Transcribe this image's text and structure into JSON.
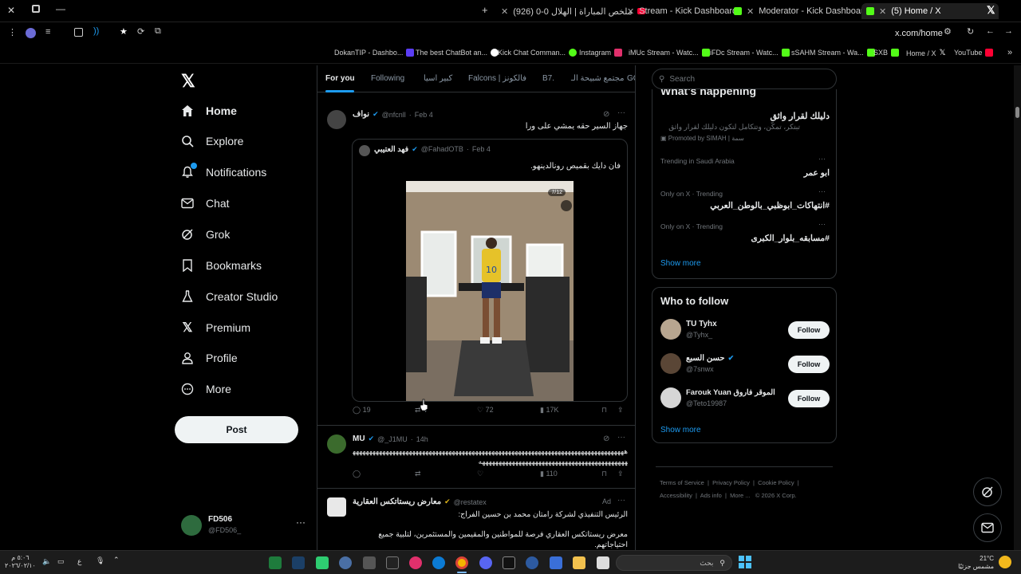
{
  "browser": {
    "tabs": [
      {
        "title": "(926) ملخص المباراة | الهلال 0-0",
        "icon_color": "#ff0033"
      },
      {
        "title": "Stream - Kick Dashboard",
        "icon_color": "#53fc18"
      },
      {
        "title": "Moderator - Kick Dashboard",
        "icon_color": "#53fc18"
      },
      {
        "title": "(5) Home / X",
        "icon_color": "#ffffff"
      }
    ],
    "url": "x.com/home",
    "bookmarks": [
      {
        "label": "DokanTIP - Dashbo...",
        "color": "#5b3df5"
      },
      {
        "label": "The best ChatBot an...",
        "color": "#ffffff"
      },
      {
        "label": "Kick Chat Comman...",
        "color": "#53fc18"
      },
      {
        "label": "Instagram",
        "color": "#e1306c"
      },
      {
        "label": "iMUc Stream - Watc...",
        "color": "#53fc18"
      },
      {
        "label": "iFDc Stream - Watc...",
        "color": "#53fc18"
      },
      {
        "label": "sSAHM Stream - Wa...",
        "color": "#53fc18"
      },
      {
        "label": "SXB",
        "color": "#53fc18"
      },
      {
        "label": "Home / X",
        "color": "#ffffff"
      },
      {
        "label": "YouTube",
        "color": "#ff0033"
      }
    ]
  },
  "sidebar": {
    "items": [
      {
        "label": "Home",
        "icon": "home-icon"
      },
      {
        "label": "Explore",
        "icon": "search-icon"
      },
      {
        "label": "Notifications",
        "icon": "bell-icon"
      },
      {
        "label": "Chat",
        "icon": "mail-icon"
      },
      {
        "label": "Grok",
        "icon": "grok-icon"
      },
      {
        "label": "Bookmarks",
        "icon": "bookmark-icon"
      },
      {
        "label": "Creator Studio",
        "icon": "flask-icon"
      },
      {
        "label": "Premium",
        "icon": "x-logo-icon"
      },
      {
        "label": "Profile",
        "icon": "person-icon"
      },
      {
        "label": "More",
        "icon": "more-circle-icon"
      }
    ],
    "post_label": "Post",
    "account": {
      "name": "FD506",
      "handle": "@FD506_"
    }
  },
  "feed": {
    "tabs": [
      "For you",
      "Following",
      "كبير اسيا",
      "Falcons | فالكونز",
      "B7.",
      "مجتمع شبيحة الـ",
      "GO"
    ],
    "post1": {
      "name": "نواف",
      "handle": "@nfcnll",
      "time": "Feb 4",
      "text": "جهاز السير حقه يمشي على ورا",
      "quote": {
        "name": "فهد العتيبي",
        "handle": "@FahadOTB",
        "time": "Feb 4",
        "text": "فان دايك بقميص رونالدينهو.",
        "media_counter": "7/12"
      },
      "stats": {
        "replies": "19",
        "reposts": "4",
        "likes": "72",
        "views": "17K"
      }
    },
    "post2": {
      "name": "MU",
      "handle": "@_J1MU",
      "time": "14h",
      "text": "هههههههههههههههههههههههههههههههههههههههههههههههههههههههههههههههههههههههههههههههههههههههههههههههههههههههههههههههههههههههههههههههه",
      "stats": {
        "replies": "",
        "reposts": "",
        "likes": "",
        "views": "110"
      }
    },
    "post3": {
      "name": "معارض ريستاتكس العقارية",
      "handle": "@restatex",
      "badge": "Ad",
      "text1": "الرئيس التنفيذي لشركة رامتان محمد بن حسين الفراج:",
      "text2": "معرض ريستاتكس العقاري فرصة للمواطنين والمقيمين والمستثمرين، لتلبية جميع احتياجاتهم."
    }
  },
  "right": {
    "search_placeholder": "Search",
    "happening_title": "What's happening",
    "promo": {
      "title": "دليلك لقرار واثق",
      "desc": "تبتكر، تمكّن، وتتكامل لتكون دليلك لقرار واثق",
      "promoted": "Promoted by SIMAH | سمة"
    },
    "trends": [
      {
        "context": "Trending in Saudi Arabia",
        "name": "ابو عمر"
      },
      {
        "context": "Only on X · Trending",
        "name": "#انتهاكات_ابوظبي_بالوطن_العربي"
      },
      {
        "context": "Only on X · Trending",
        "name": "#مسابقه_بلوار_الكبرى"
      }
    ],
    "show_more": "Show more",
    "who_to_follow": "Who to follow",
    "follow_suggestions": [
      {
        "name": "TU Tyhx",
        "handle": "@Tyhx_",
        "verified": false
      },
      {
        "name": "حسن السبع",
        "handle": "@7snwx",
        "verified": true
      },
      {
        "name": "Farouk Yuan الموقر فاروق",
        "handle": "@Teto19987",
        "verified": false
      }
    ],
    "follow_label": "Follow",
    "footer": [
      "Terms of Service",
      "Privacy Policy",
      "Cookie Policy",
      "Accessibility",
      "Ads info",
      "More ...",
      "© 2026 X Corp."
    ]
  },
  "taskbar": {
    "search_placeholder": "بحث",
    "time": "٥:٠٦ م",
    "date": "٢٠٢٦/٠٢/١٠",
    "weather_temp": "21°C",
    "weather_desc": "مشمس جزئيًا",
    "lang": "ع"
  }
}
